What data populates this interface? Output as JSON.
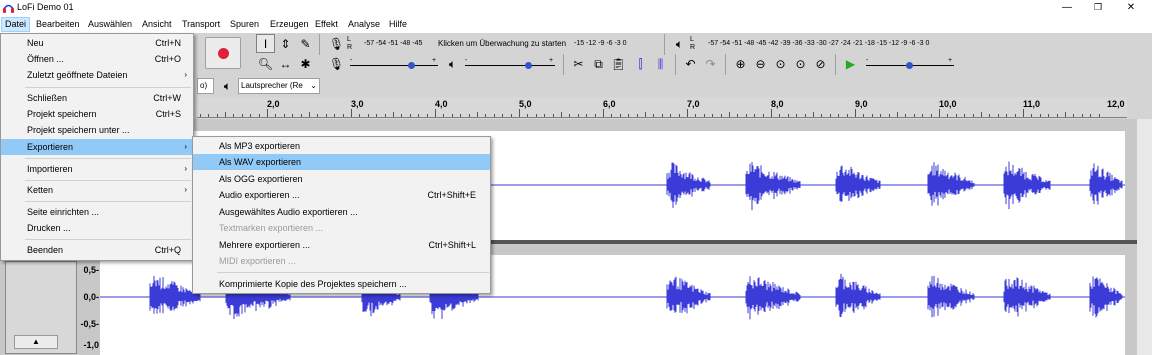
{
  "window": {
    "title": "LoFi Demo 01",
    "minimize": "—",
    "maximize": "❐",
    "close": "✕"
  },
  "menubar": [
    "Datei",
    "Bearbeiten",
    "Auswählen",
    "Ansicht",
    "Transport",
    "Spuren",
    "Erzeugen",
    "Effekt",
    "Analyse",
    "Hilfe"
  ],
  "record_meter": {
    "channels": "L\nR",
    "scale_left": "-57 -54 -51 -48 -45",
    "prompt": "Klicken um Überwachung zu starten",
    "scale_right": "-15 -12 -9 -6 -3 0"
  },
  "playback_meter": {
    "scale": "-57 -54 -51 -48 -45 -42 -39 -36 -33 -30 -27 -24 -21 -18 -15 -12 -9 -6 -3 0"
  },
  "device_bar": {
    "input_fragment": "o)",
    "output_device": "Lautsprecher (Re"
  },
  "ruler": [
    "2,0",
    "3,0",
    "4,0",
    "5,0",
    "6,0",
    "7,0",
    "8,0",
    "9,0",
    "10,0",
    "11,0",
    "12,0"
  ],
  "track2": {
    "amp_labels": [
      "0,5-",
      "0,0-",
      "-0,5-",
      "-1,0"
    ],
    "collapse": "▲"
  },
  "datei_menu": {
    "items": [
      {
        "label": "Neu",
        "shortcut": "Ctrl+N"
      },
      {
        "label": "Öffnen ...",
        "shortcut": "Ctrl+O"
      },
      {
        "label": "Zuletzt geöffnete Dateien",
        "submenu": "›"
      },
      {
        "label": "Schließen",
        "shortcut": "Ctrl+W"
      },
      {
        "label": "Projekt speichern",
        "shortcut": "Ctrl+S"
      },
      {
        "label": "Projekt speichern unter ..."
      },
      {
        "label": "Exportieren",
        "submenu": "›"
      },
      {
        "label": "Importieren",
        "submenu": "›"
      },
      {
        "label": "Ketten",
        "submenu": "›"
      },
      {
        "label": "Seite einrichten ..."
      },
      {
        "label": "Drucken ..."
      },
      {
        "label": "Beenden",
        "shortcut": "Ctrl+Q"
      }
    ]
  },
  "export_menu": {
    "items": [
      {
        "label": "Als MP3 exportieren"
      },
      {
        "label": "Als WAV exportieren"
      },
      {
        "label": "Als OGG exportieren"
      },
      {
        "label": "Audio exportieren ...",
        "shortcut": "Ctrl+Shift+E"
      },
      {
        "label": "Ausgewähltes Audio exportieren ..."
      },
      {
        "label": "Textmarken exportieren ..."
      },
      {
        "label": "Mehrere exportieren ...",
        "shortcut": "Ctrl+Shift+L"
      },
      {
        "label": "MIDI exportieren ..."
      },
      {
        "label": "Komprimierte Kopie des Projektes speichern ..."
      }
    ]
  },
  "colors": {
    "waveform": "#3b3bd8",
    "menu_highlight": "#91c9f7",
    "record_button": "#e0203a"
  }
}
